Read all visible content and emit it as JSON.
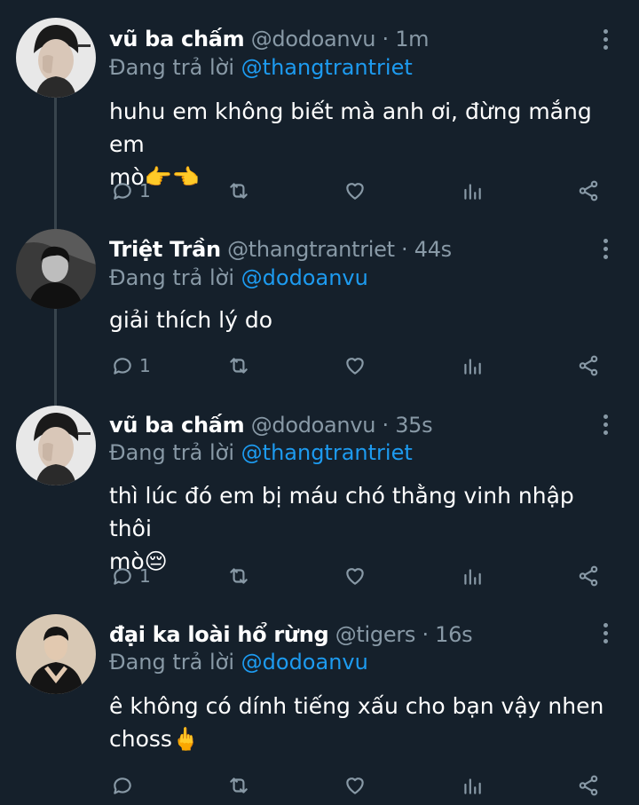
{
  "tweets": [
    {
      "name": "vũ ba chấm",
      "handle": "@dodoanvu",
      "sep": "·",
      "time": "1m",
      "replying_prefix": "Đang trả lời",
      "replying_to": "@thangtrantriet",
      "text_lines": [
        "huhu em không biết mà anh ơi, đừng mắng em",
        "mò👉👈"
      ],
      "reply_count": "1",
      "retweet_count": "",
      "like_count": ""
    },
    {
      "name": "Triệt Trần",
      "handle": "@thangtrantriet",
      "sep": "·",
      "time": "44s",
      "replying_prefix": "Đang trả lời",
      "replying_to": "@dodoanvu",
      "text_lines": [
        "giải thích lý do"
      ],
      "reply_count": "1",
      "retweet_count": "",
      "like_count": ""
    },
    {
      "name": "vũ ba chấm",
      "handle": "@dodoanvu",
      "sep": "·",
      "time": "35s",
      "replying_prefix": "Đang trả lời",
      "replying_to": "@thangtrantriet",
      "text_lines": [
        "thì lúc đó em bị máu chó thằng vinh nhập thôi",
        "mò😔"
      ],
      "reply_count": "1",
      "retweet_count": "",
      "like_count": ""
    },
    {
      "name": "đại ka loài hổ rừng",
      "handle": "@tigers",
      "sep": "·",
      "time": "16s",
      "replying_prefix": "Đang trả lời",
      "replying_to": "@dodoanvu",
      "text_lines": [
        "ê không có dính tiếng xấu cho bạn vậy nhen",
        "choss🖕"
      ],
      "reply_count": "",
      "retweet_count": "",
      "like_count": ""
    }
  ],
  "icons": {
    "reply": "reply-icon",
    "retweet": "retweet-icon",
    "like": "heart-icon",
    "analytics": "analytics-icon",
    "share": "share-icon",
    "more": "more-vertical-icon"
  },
  "colors": {
    "background": "#15202b",
    "text": "#ffffff",
    "muted": "#8899a6",
    "link": "#1d9bf0",
    "thread_line": "#38444d"
  }
}
